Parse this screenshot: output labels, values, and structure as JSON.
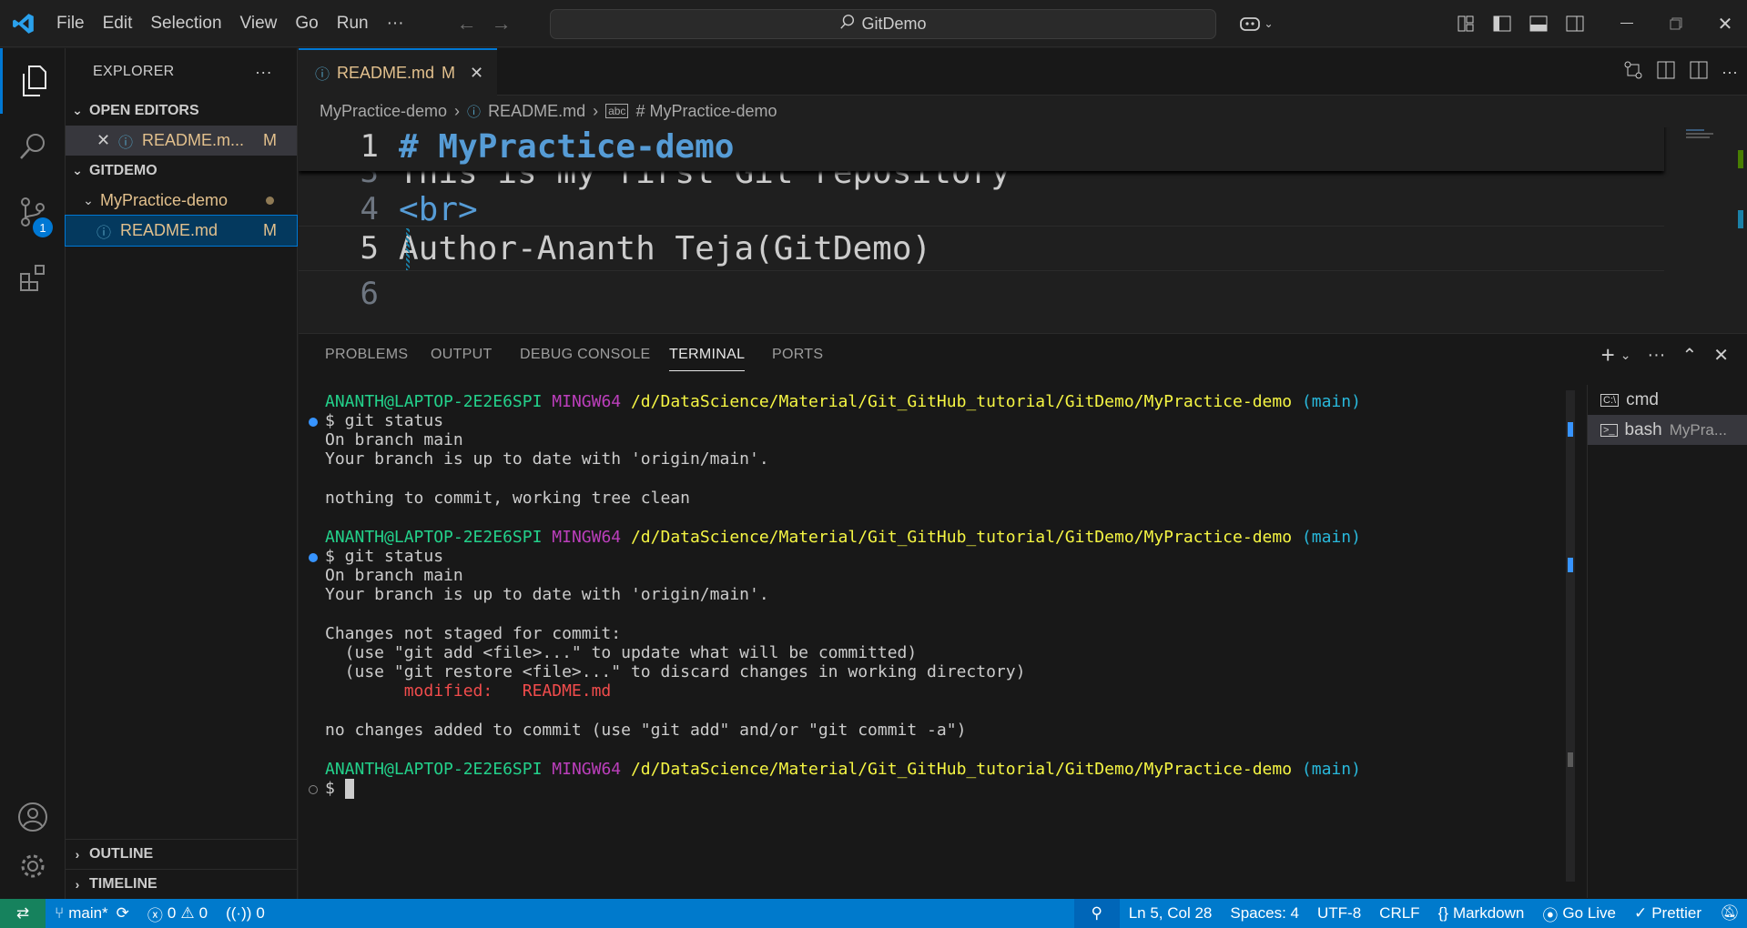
{
  "titlebar": {
    "menu": [
      "File",
      "Edit",
      "Selection",
      "View",
      "Go",
      "Run",
      "···"
    ],
    "search": "GitDemo"
  },
  "activity": {
    "scm_badge": "1"
  },
  "sidebar": {
    "title": "EXPLORER",
    "open_editors_label": "OPEN EDITORS",
    "open_editor_file": "README.m...",
    "open_editor_status": "M",
    "workspace_label": "GITDEMO",
    "folder": "MyPractice-demo",
    "file": "README.md",
    "file_status": "M",
    "outline_label": "OUTLINE",
    "timeline_label": "TIMELINE"
  },
  "editor": {
    "tab_label": "README.md",
    "tab_status": "M",
    "breadcrumbs": [
      "MyPractice-demo",
      "README.md",
      "# MyPractice-demo"
    ],
    "lines": [
      {
        "num": "1",
        "text": "# MyPractice-demo"
      },
      {
        "num": "3",
        "text": "This is my first Git repository"
      },
      {
        "num": "4",
        "text": "<br>"
      },
      {
        "num": "5",
        "text": "Author-Ananth Teja(GitDemo)"
      },
      {
        "num": "6",
        "text": ""
      }
    ]
  },
  "panel": {
    "tabs": [
      "PROBLEMS",
      "OUTPUT",
      "DEBUG CONSOLE",
      "TERMINAL",
      "PORTS"
    ],
    "terminals": [
      {
        "name": "cmd",
        "detail": ""
      },
      {
        "name": "bash",
        "detail": "MyPra..."
      }
    ],
    "prompt": {
      "user": "ANANTH@LAPTOP-2E2E6SPI",
      "env": "MINGW64",
      "path": "/d/DataScience/Material/Git_GitHub_tutorial/GitDemo/MyPractice-demo",
      "branch": "(main)"
    },
    "terminal_lines": {
      "cmd1": "$ git status",
      "l1": "On branch main",
      "l2": "Your branch is up to date with 'origin/main'.",
      "l3": "nothing to commit, working tree clean",
      "cmd2": "$ git status",
      "l4": "On branch main",
      "l5": "Your branch is up to date with 'origin/main'.",
      "l6": "Changes not staged for commit:",
      "l7": "  (use \"git add <file>...\" to update what will be committed)",
      "l8": "  (use \"git restore <file>...\" to discard changes in working directory)",
      "l9": "        modified:   README.md",
      "l10": "no changes added to commit (use \"git add\" and/or \"git commit -a\")",
      "cmd3": "$ "
    }
  },
  "statusbar": {
    "branch": "main*",
    "errors": "0",
    "warnings": "0",
    "ports": "0",
    "position": "Ln 5, Col 28",
    "spaces": "Spaces: 4",
    "encoding": "UTF-8",
    "eol": "CRLF",
    "language": "Markdown",
    "golive": "Go Live",
    "prettier": "Prettier"
  },
  "colors": {
    "accent": "#0078d4",
    "status": "#007acc",
    "heading": "#569cd6",
    "modified": "#e2c08d"
  }
}
